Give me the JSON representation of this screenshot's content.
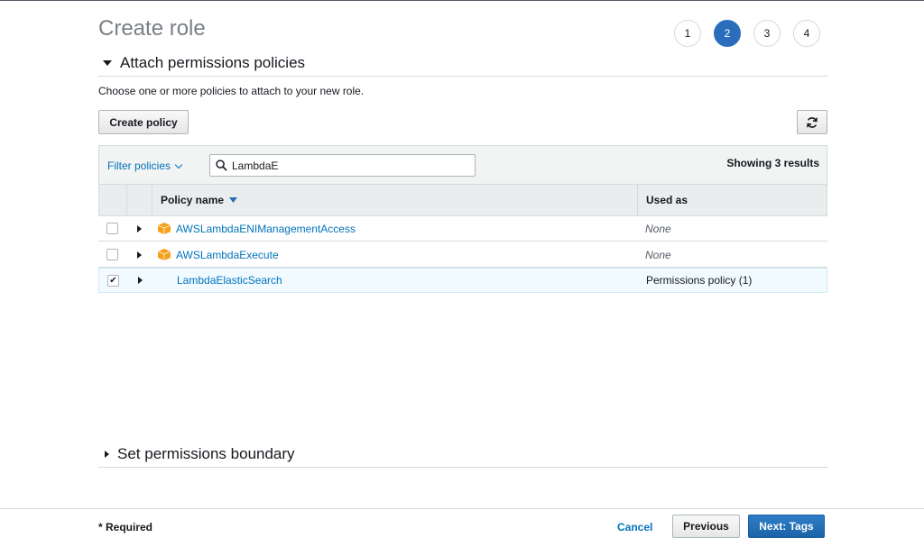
{
  "page": {
    "title": "Create role"
  },
  "steps": [
    {
      "label": "1",
      "active": false
    },
    {
      "label": "2",
      "active": true
    },
    {
      "label": "3",
      "active": false
    },
    {
      "label": "4",
      "active": false
    }
  ],
  "attach_section": {
    "title": "Attach permissions policies",
    "description": "Choose one or more policies to attach to your new role.",
    "create_policy_label": "Create policy",
    "refresh_icon": "refresh-icon"
  },
  "filter": {
    "label": "Filter policies",
    "search_value": "LambdaE",
    "results_text": "Showing 3 results"
  },
  "table": {
    "columns": {
      "policy_name": "Policy name",
      "used_as": "Used as"
    },
    "rows": [
      {
        "name": "AWSLambdaENIManagementAccess",
        "used_as": "None",
        "checked": false,
        "aws_managed": true
      },
      {
        "name": "AWSLambdaExecute",
        "used_as": "None",
        "checked": false,
        "aws_managed": true
      },
      {
        "name": "LambdaElasticSearch",
        "used_as": "Permissions policy (1)",
        "checked": true,
        "aws_managed": false
      }
    ]
  },
  "boundary_section": {
    "title": "Set permissions boundary"
  },
  "footer": {
    "required_label": "* Required",
    "cancel_label": "Cancel",
    "previous_label": "Previous",
    "next_label": "Next: Tags"
  },
  "colors": {
    "accent": "#2a6ebb",
    "link": "#0073bb",
    "package": "#f7a01b"
  }
}
